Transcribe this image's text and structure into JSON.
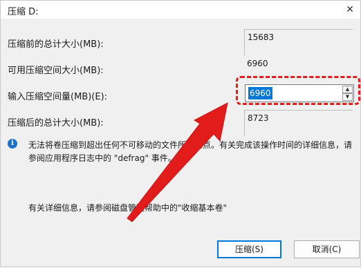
{
  "window": {
    "title": "压缩 D:",
    "close_glyph": "✕"
  },
  "rows": [
    {
      "label": "压缩前的总计大小(MB):",
      "value": "15683"
    },
    {
      "label": "可用压缩空间大小(MB):",
      "value": "6960"
    },
    {
      "label": "输入压缩空间量(MB)(E):",
      "value": "6960"
    },
    {
      "label": "压缩后的总计大小(MB):",
      "value": "8723"
    }
  ],
  "spinner": {
    "up_glyph": "▲",
    "down_glyph": "▼"
  },
  "info": {
    "icon_glyph": "i",
    "text": "无法将卷压缩到超出任何不可移动的文件所在的点。有关完成该操作时间的详细信息，请参阅应用程序日志中的 \"defrag\" 事件。"
  },
  "help_text": "有关详细信息，请参阅磁盘管理帮助中的\"收缩基本卷\"",
  "buttons": {
    "shrink": "压缩(S)",
    "cancel": "取消(C)"
  },
  "colors": {
    "accent": "#0078d7",
    "annotation": "#e21b1b"
  }
}
